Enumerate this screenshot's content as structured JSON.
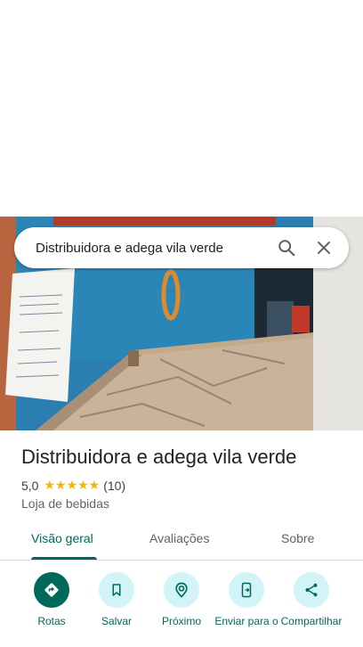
{
  "search": {
    "query": "Distribuidora e adega vila verde"
  },
  "place": {
    "name": "Distribuidora e adega vila verde",
    "rating": "5,0",
    "stars": "★★★★★",
    "review_count": "(10)",
    "category": "Loja de bebidas"
  },
  "tabs": [
    {
      "label": "Visão geral",
      "active": true
    },
    {
      "label": "Avaliações",
      "active": false
    },
    {
      "label": "Sobre",
      "active": false
    }
  ],
  "actions": [
    {
      "label": "Rotas",
      "icon": "directions-icon"
    },
    {
      "label": "Salvar",
      "icon": "bookmark-icon"
    },
    {
      "label": "Próximo",
      "icon": "nearby-icon"
    },
    {
      "label": "Enviar para o",
      "icon": "send-to-phone-icon"
    },
    {
      "label": "Compartilhar",
      "icon": "share-icon"
    }
  ],
  "colors": {
    "accent": "#00695c",
    "action_bg": "#d2f3f8",
    "star": "#f4b400"
  }
}
